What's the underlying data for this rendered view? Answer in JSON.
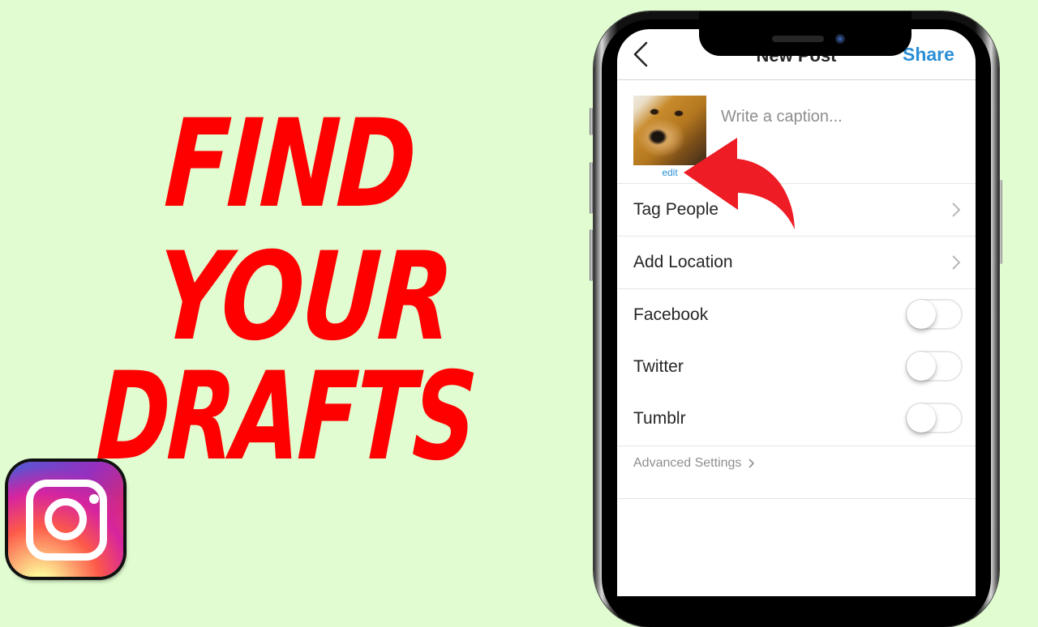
{
  "headline": {
    "line1": "FIND",
    "line2": "YOUR",
    "line3": "DRAFTS",
    "color": "#ff0000"
  },
  "background_color": "#e0fcd0",
  "logo": {
    "name": "instagram-logo"
  },
  "phone": {
    "nav": {
      "back_icon": "chevron-left-icon",
      "title": "New Post",
      "share_label": "Share",
      "accent_color": "#2a8fd6"
    },
    "post": {
      "thumbnail_alt": "dog photo",
      "edit_label": "edit",
      "caption_placeholder": "Write a caption...",
      "caption_value": ""
    },
    "rows": [
      {
        "label": "Tag People",
        "type": "link"
      },
      {
        "label": "Add Location",
        "type": "link"
      },
      {
        "label": "Facebook",
        "type": "toggle",
        "on": false
      },
      {
        "label": "Twitter",
        "type": "toggle",
        "on": false
      },
      {
        "label": "Tumblr",
        "type": "toggle",
        "on": false
      }
    ],
    "advanced_settings_label": "Advanced Settings"
  },
  "annotation": {
    "arrow_color": "#ee1c25",
    "points_to": "edit"
  }
}
